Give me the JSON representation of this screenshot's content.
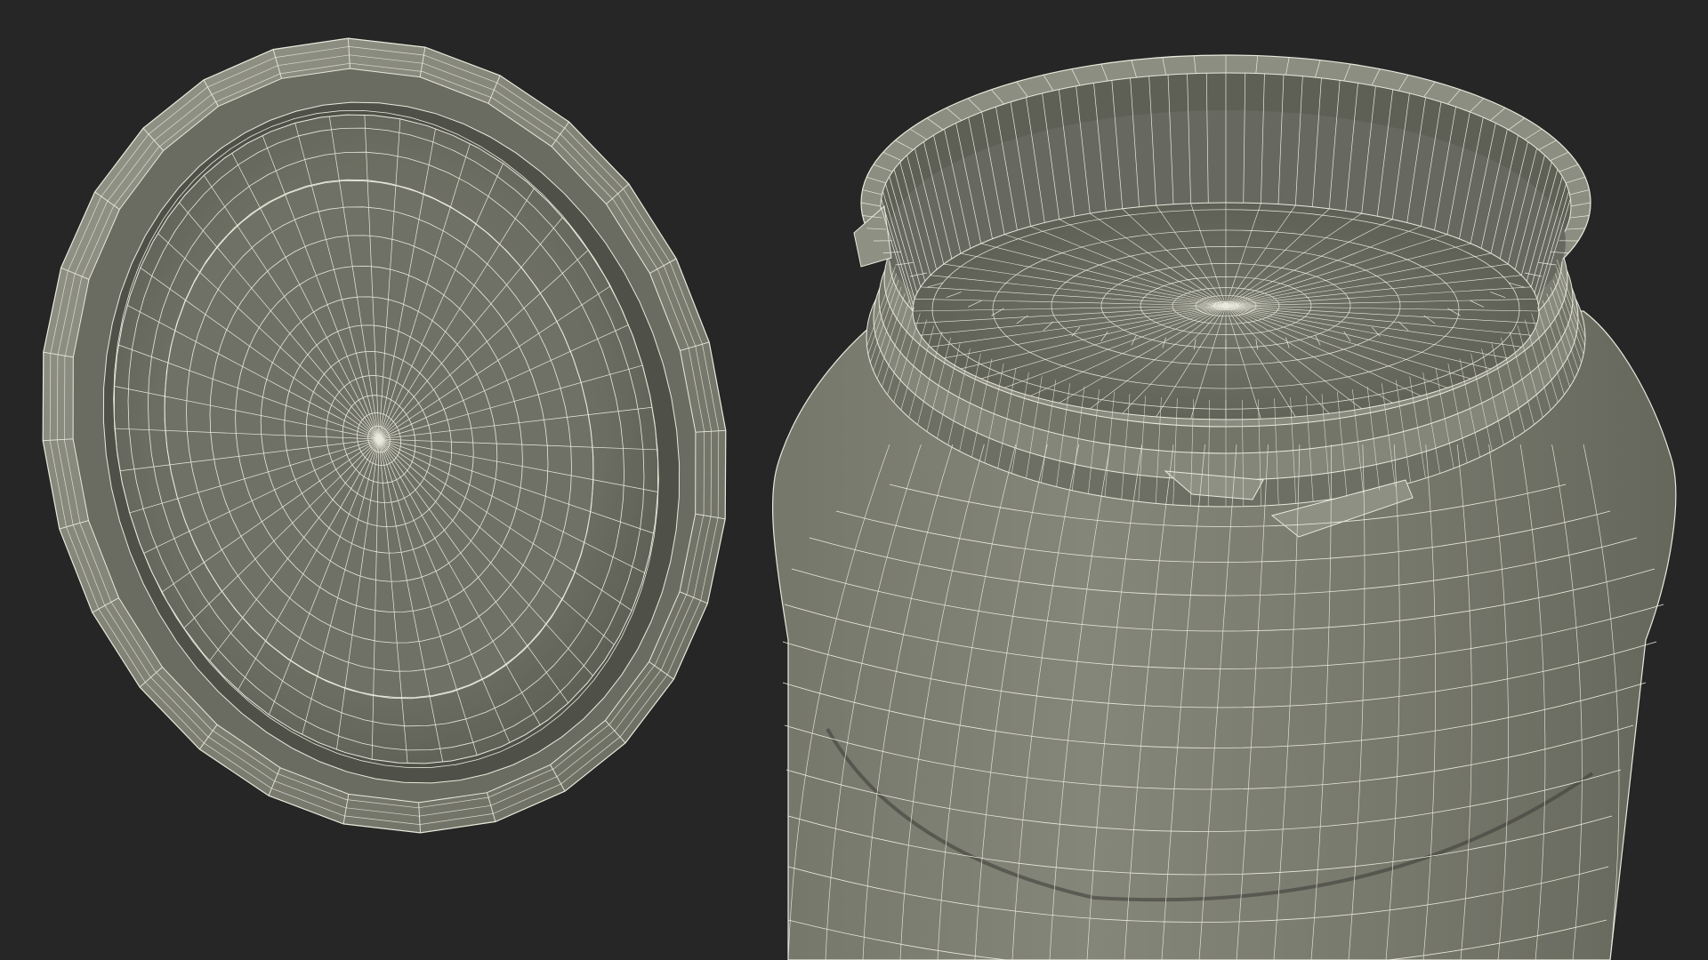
{
  "scene": {
    "background": "#262626",
    "mesh_fill_light": "#8a8b7e",
    "mesh_fill_mid": "#737468",
    "mesh_fill_dark": "#55564d",
    "wire_color": "#e9e9dc",
    "objects": [
      {
        "name": "jar-lid",
        "view": "underside",
        "render": "wireframe-over-shaded"
      },
      {
        "name": "jar-body",
        "view": "open-top",
        "render": "wireframe-over-shaded"
      }
    ]
  }
}
